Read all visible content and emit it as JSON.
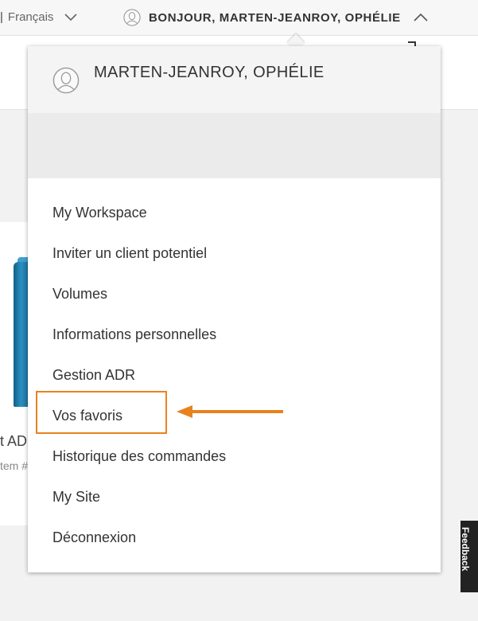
{
  "topbar": {
    "language_separator": "|",
    "language_label": "Français",
    "greeting": "BONJOUR, MARTEN-JEANROY, OPHÉLIE"
  },
  "background_card": {
    "name_fragment": "t AD",
    "item_fragment": "tem #"
  },
  "dropdown": {
    "user_name": "MARTEN-JEANROY, OPHÉLIE",
    "items": [
      {
        "label": "My Workspace"
      },
      {
        "label": "Inviter un client potentiel"
      },
      {
        "label": "Volumes"
      },
      {
        "label": "Informations personnelles"
      },
      {
        "label": "Gestion ADR"
      },
      {
        "label": "Vos favoris"
      },
      {
        "label": "Historique des commandes"
      },
      {
        "label": "My Site"
      },
      {
        "label": "Déconnexion"
      }
    ]
  },
  "annotation": {
    "highlighted_item": "Vos favoris",
    "color": "#e8821e"
  },
  "feedback": {
    "label": "Feedback"
  },
  "icons": [
    "chevron-down-icon",
    "user-avatar-icon",
    "chevron-up-icon",
    "arrow-left-icon"
  ]
}
